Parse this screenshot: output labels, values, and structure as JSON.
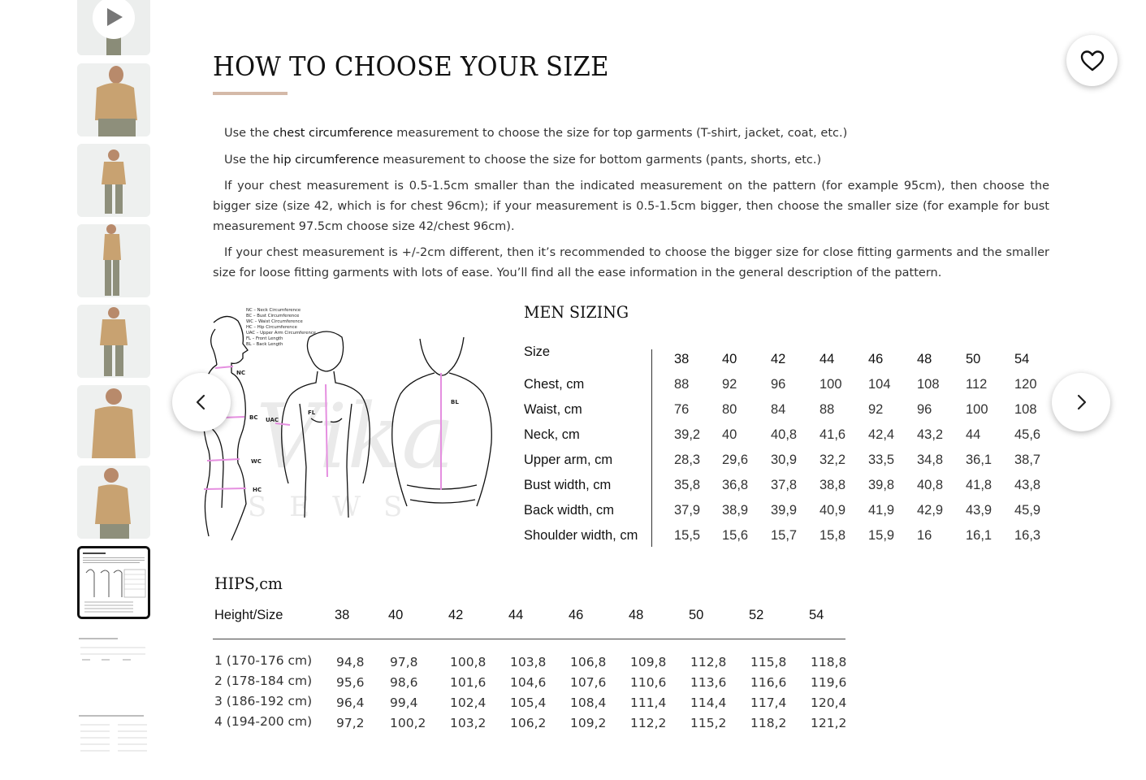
{
  "gallery": {
    "video_play_icon": "play-icon",
    "thumbnail_count": 10,
    "active_index": 7
  },
  "size_guide": {
    "title": "HOW TO CHOOSE YOUR SIZE",
    "accent_color": "#d4b9a8",
    "paragraphs": {
      "p1_pre": "Use the ",
      "p1_bold": "chest circumference",
      "p1_post": " measurement to choose the size for top garments (T-shirt, jacket, coat, etc.)",
      "p2_pre": "Use the ",
      "p2_bold": "hip circumference",
      "p2_post": " measurement to choose the size for bottom garments (pants, shorts, etc.)",
      "p3": "If your chest measurement is 0.5-1.5cm smaller than the indicated measurement on the pattern (for example 95cm), then choose the bigger size (size 42, which is for chest 96cm); if your measurement is 0.5-1.5cm bigger, then choose the smaller size (for example for bust measurement 97.5cm choose size 42/chest 96cm).",
      "p4": "If your chest measurement is +/-2cm different, then it’s recommended to choose the bigger size for close fitting garments and the smaller size for loose fitting garments with lots of ease. You’ll find all the ease information in the general description of the pattern."
    },
    "figure": {
      "legend": [
        "NC – Neck Circumference",
        "BC – Bust Circumference",
        "WC – Waist Circumference",
        "HC – Hip Circumference",
        "UAC – Upper Arm Circumference",
        "FL – Front Length",
        "BL – Back Length"
      ],
      "labels": {
        "nc": "NC",
        "bc": "BC",
        "wc": "WC",
        "hc": "HC",
        "uac": "UAC",
        "fl": "FL",
        "bl": "BL"
      },
      "marker_color": "#e58fe0"
    },
    "men_sizing": {
      "title": "MEN SIZING",
      "size_label": "Size",
      "sizes": [
        "38",
        "40",
        "42",
        "44",
        "46",
        "48",
        "50",
        "54"
      ],
      "rows": [
        {
          "label": "Chest, cm",
          "values": [
            "88",
            "92",
            "96",
            "100",
            "104",
            "108",
            "112",
            "120"
          ]
        },
        {
          "label": "Waist, cm",
          "values": [
            "76",
            "80",
            "84",
            "88",
            "92",
            "96",
            "100",
            "108"
          ]
        },
        {
          "label": "Neck, cm",
          "values": [
            "39,2",
            "40",
            "40,8",
            "41,6",
            "42,4",
            "43,2",
            "44",
            "45,6"
          ]
        },
        {
          "label": "Upper arm, cm",
          "values": [
            "28,3",
            "29,6",
            "30,9",
            "32,2",
            "33,5",
            "34,8",
            "36,1",
            "38,7"
          ]
        },
        {
          "label": "Bust width, cm",
          "values": [
            "35,8",
            "36,8",
            "37,8",
            "38,8",
            "39,8",
            "40,8",
            "41,8",
            "43,8"
          ]
        },
        {
          "label": "Back width, cm",
          "values": [
            "37,9",
            "38,9",
            "39,9",
            "40,9",
            "41,9",
            "42,9",
            "43,9",
            "45,9"
          ]
        },
        {
          "label": "Shoulder width, cm",
          "values": [
            "15,5",
            "15,6",
            "15,7",
            "15,8",
            "15,9",
            "16",
            "16,1",
            "16,3"
          ]
        }
      ]
    },
    "hips": {
      "title": "HIPS,cm",
      "header_label": "Height/Size",
      "sizes": [
        "38",
        "40",
        "42",
        "44",
        "46",
        "48",
        "50",
        "52",
        "54"
      ],
      "rows": [
        {
          "label": "1 (170-176 cm)",
          "values": [
            "94,8",
            "97,8",
            "100,8",
            "103,8",
            "106,8",
            "109,8",
            "112,8",
            "115,8",
            "118,8"
          ]
        },
        {
          "label": "2 (178-184 cm)",
          "values": [
            "95,6",
            "98,6",
            "101,6",
            "104,6",
            "107,6",
            "110,6",
            "113,6",
            "116,6",
            "119,6"
          ]
        },
        {
          "label": "3 (186-192 cm)",
          "values": [
            "96,4",
            "99,4",
            "102,4",
            "105,4",
            "108,4",
            "111,4",
            "114,4",
            "117,4",
            "120,4"
          ]
        },
        {
          "label": "4 (194-200 cm)",
          "values": [
            "97,2",
            "100,2",
            "103,2",
            "106,2",
            "109,2",
            "112,2",
            "115,2",
            "118,2",
            "121,2"
          ]
        }
      ]
    }
  },
  "controls": {
    "prev_icon": "chevron-left-icon",
    "next_icon": "chevron-right-icon",
    "favorite_icon": "heart-icon"
  }
}
